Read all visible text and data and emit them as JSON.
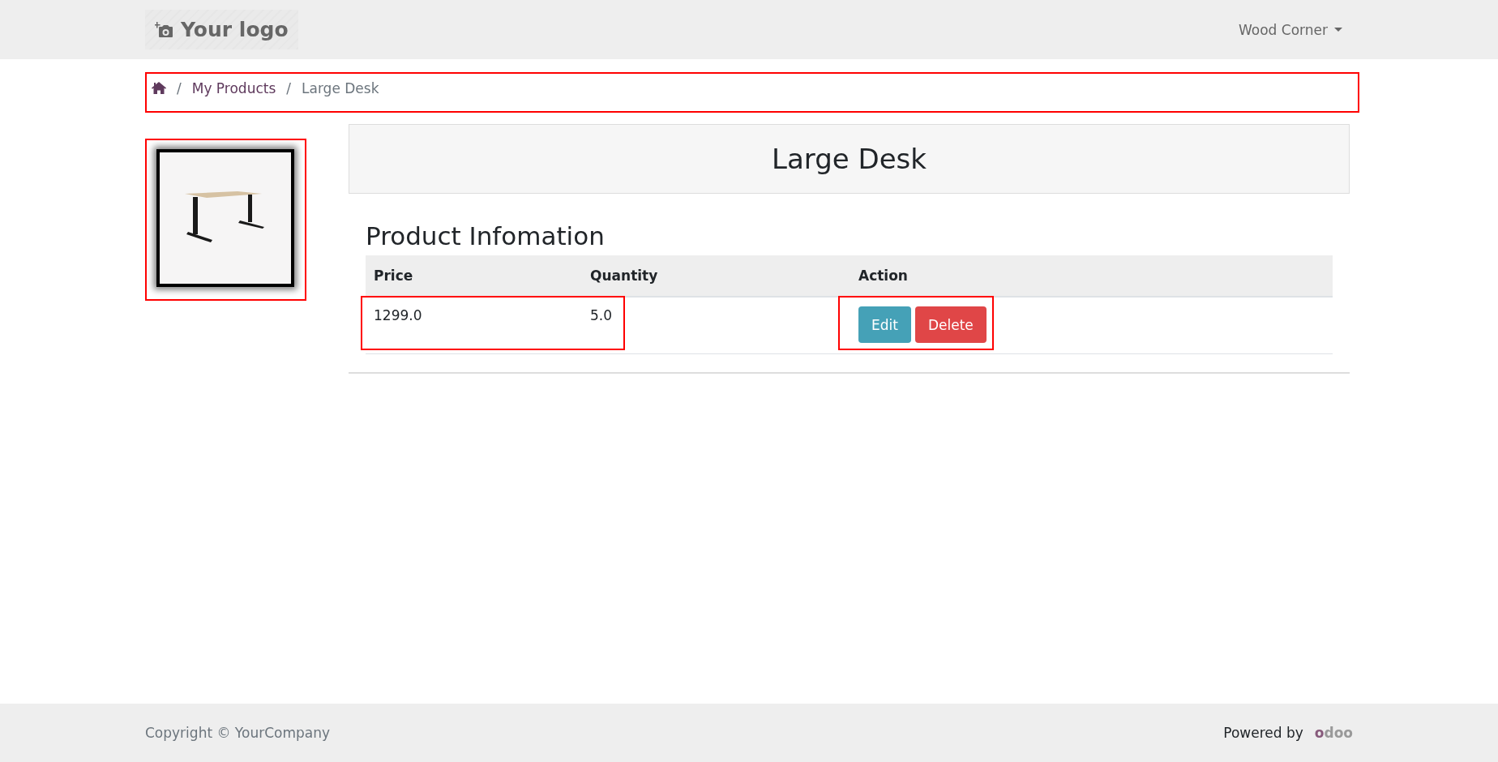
{
  "header": {
    "logo": "Your logo",
    "user_menu": "Wood Corner"
  },
  "breadcrumb": {
    "items": [
      "My Products"
    ],
    "separator": "/",
    "current": "Large Desk"
  },
  "product": {
    "title": "Large Desk",
    "section_title": "Product Infomation",
    "table": {
      "columns": [
        "Price",
        "Quantity",
        "Action"
      ],
      "rows": [
        {
          "price": "1299.0",
          "quantity": "5.0",
          "actions": [
            {
              "label": "Edit",
              "kind": "info"
            },
            {
              "label": "Delete",
              "kind": "danger"
            }
          ]
        }
      ]
    }
  },
  "footer": {
    "copyright": "Copyright © YourCompany",
    "powered_by": "Powered by",
    "brand": "odoo"
  }
}
